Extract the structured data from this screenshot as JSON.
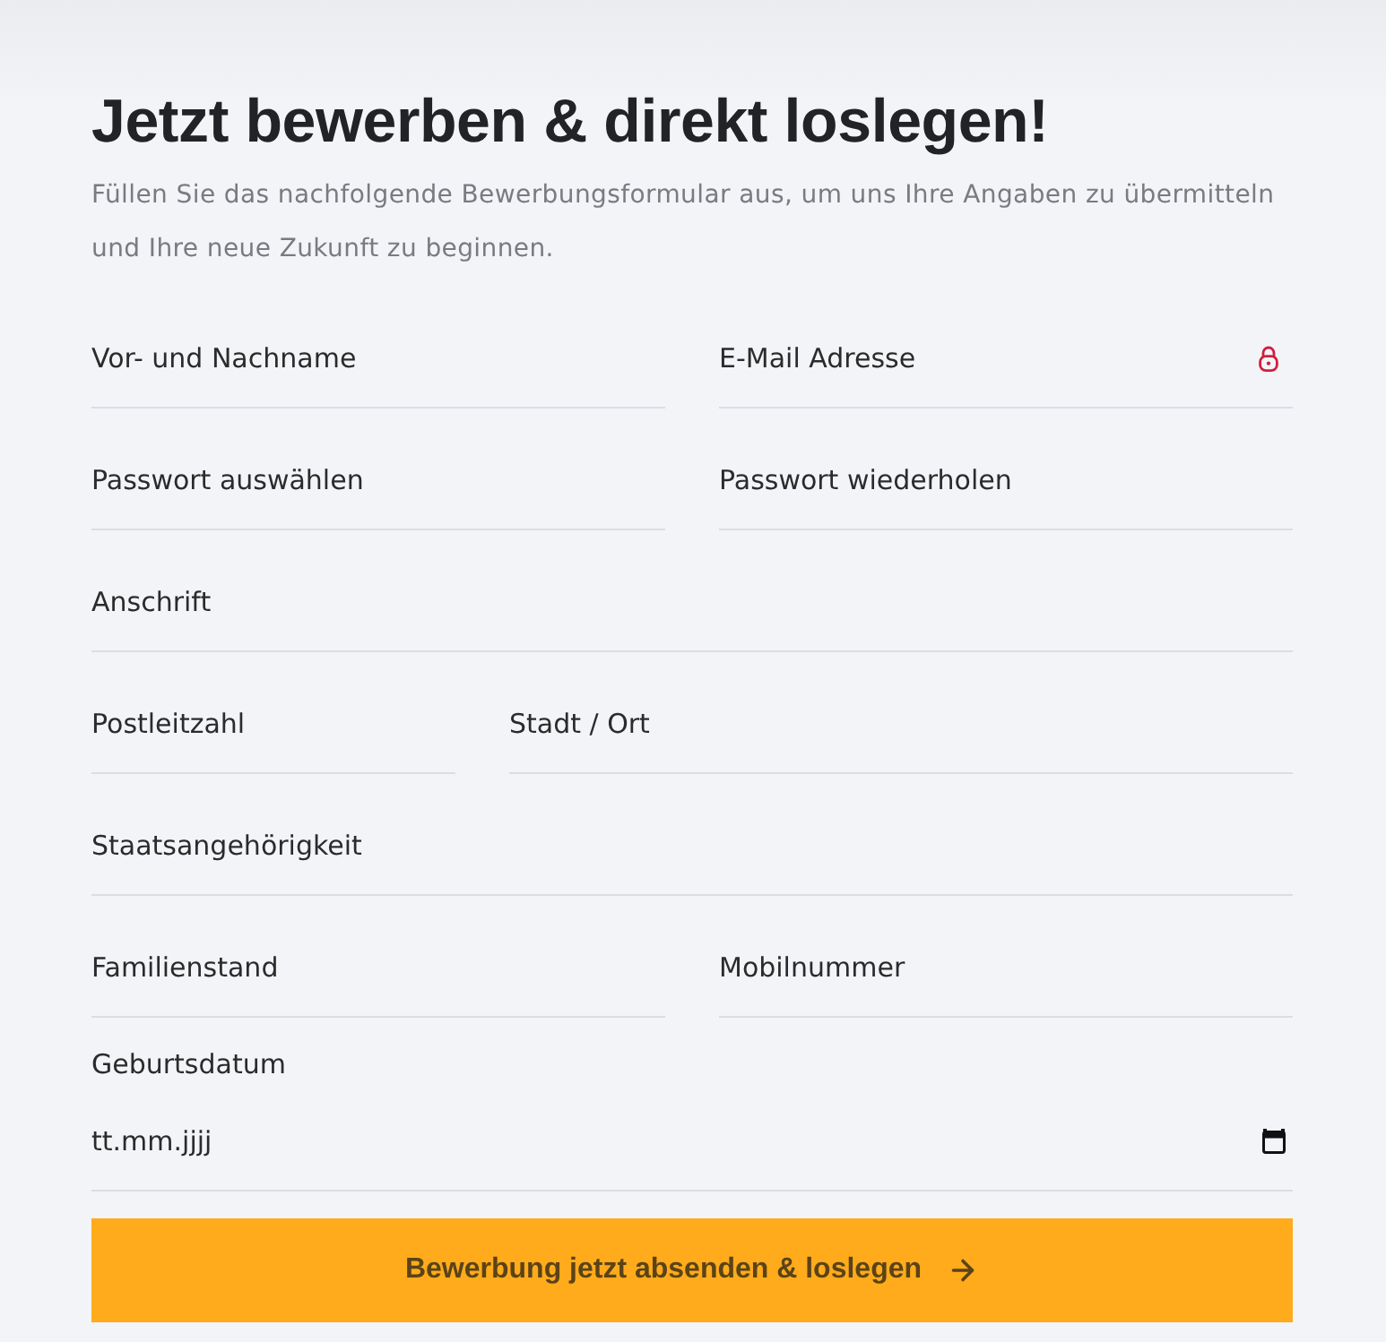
{
  "heading": "Jetzt bewerben & direkt loslegen!",
  "intro": "Füllen Sie das nachfolgende Bewerbungsformular aus, um uns Ihre Angaben zu übermitteln und Ihre neue Zukunft zu beginnen.",
  "rows": [
    {
      "fields": [
        {
          "kind": "text",
          "placeholder": "Vor- und Nachname"
        },
        {
          "kind": "email",
          "placeholder": "E-Mail Adresse"
        }
      ]
    },
    {
      "fields": [
        {
          "kind": "text",
          "placeholder": "Passwort auswählen"
        },
        {
          "kind": "text",
          "placeholder": "Passwort wiederholen"
        }
      ]
    },
    {
      "fields": [
        {
          "kind": "text",
          "placeholder": "Anschrift"
        }
      ]
    },
    {
      "fields": [
        {
          "kind": "postal",
          "placeholder": "Postleitzahl"
        },
        {
          "kind": "text",
          "placeholder": "Stadt / Ort"
        }
      ]
    },
    {
      "fields": [
        {
          "kind": "text",
          "placeholder": "Staatsangehörigkeit"
        }
      ]
    },
    {
      "fields": [
        {
          "kind": "text",
          "placeholder": "Familienstand"
        },
        {
          "kind": "text",
          "placeholder": "Mobilnummer"
        }
      ]
    },
    {
      "fields": [
        {
          "kind": "date",
          "label": "Geburtsdatum",
          "placeholder": "tt.mm.jjjj"
        }
      ]
    }
  ],
  "submit": {
    "label": "Bewerbung jetzt absenden & loslegen"
  }
}
